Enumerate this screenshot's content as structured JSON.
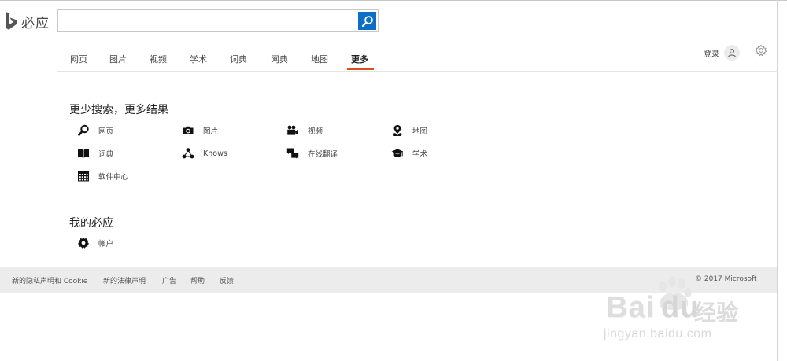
{
  "brand": {
    "name": "必应"
  },
  "search": {
    "value": "",
    "placeholder": ""
  },
  "nav": {
    "tabs": [
      {
        "label": "网页"
      },
      {
        "label": "图片"
      },
      {
        "label": "视频"
      },
      {
        "label": "学术"
      },
      {
        "label": "词典"
      },
      {
        "label": "网典"
      },
      {
        "label": "地图"
      },
      {
        "label": "更多",
        "active": true
      }
    ]
  },
  "account": {
    "signin_label": "登录"
  },
  "more_section": {
    "title": "更少搜索，更多结果",
    "items": [
      {
        "label": "网页",
        "icon": "search-icon"
      },
      {
        "label": "图片",
        "icon": "camera-icon"
      },
      {
        "label": "视频",
        "icon": "video-camera-icon"
      },
      {
        "label": "地图",
        "icon": "map-pin-icon"
      },
      {
        "label": "词典",
        "icon": "book-icon"
      },
      {
        "label": "Knows",
        "icon": "knows-nodes-icon"
      },
      {
        "label": "在线翻译",
        "icon": "translate-bubbles-icon"
      },
      {
        "label": "学术",
        "icon": "graduation-cap-icon"
      },
      {
        "label": "软件中心",
        "icon": "software-grid-icon"
      }
    ]
  },
  "mine_section": {
    "title": "我的必应",
    "items": [
      {
        "label": "帐户",
        "icon": "gear-icon"
      }
    ]
  },
  "footer": {
    "links": [
      {
        "label": "新的隐私声明和 Cookie"
      },
      {
        "label": "新的法律声明"
      },
      {
        "label": "广告"
      },
      {
        "label": "帮助"
      },
      {
        "label": "反馈"
      }
    ],
    "copyright": "© 2017 Microsoft"
  },
  "watermark": {
    "main": "Bai",
    "paw": "du",
    "cn": "经验",
    "sub": "jingyan.baidu.com"
  },
  "colors": {
    "accent_blue": "#0c6ec4",
    "active_tab_underline": "#d9501e",
    "footer_bg": "#ececec"
  }
}
